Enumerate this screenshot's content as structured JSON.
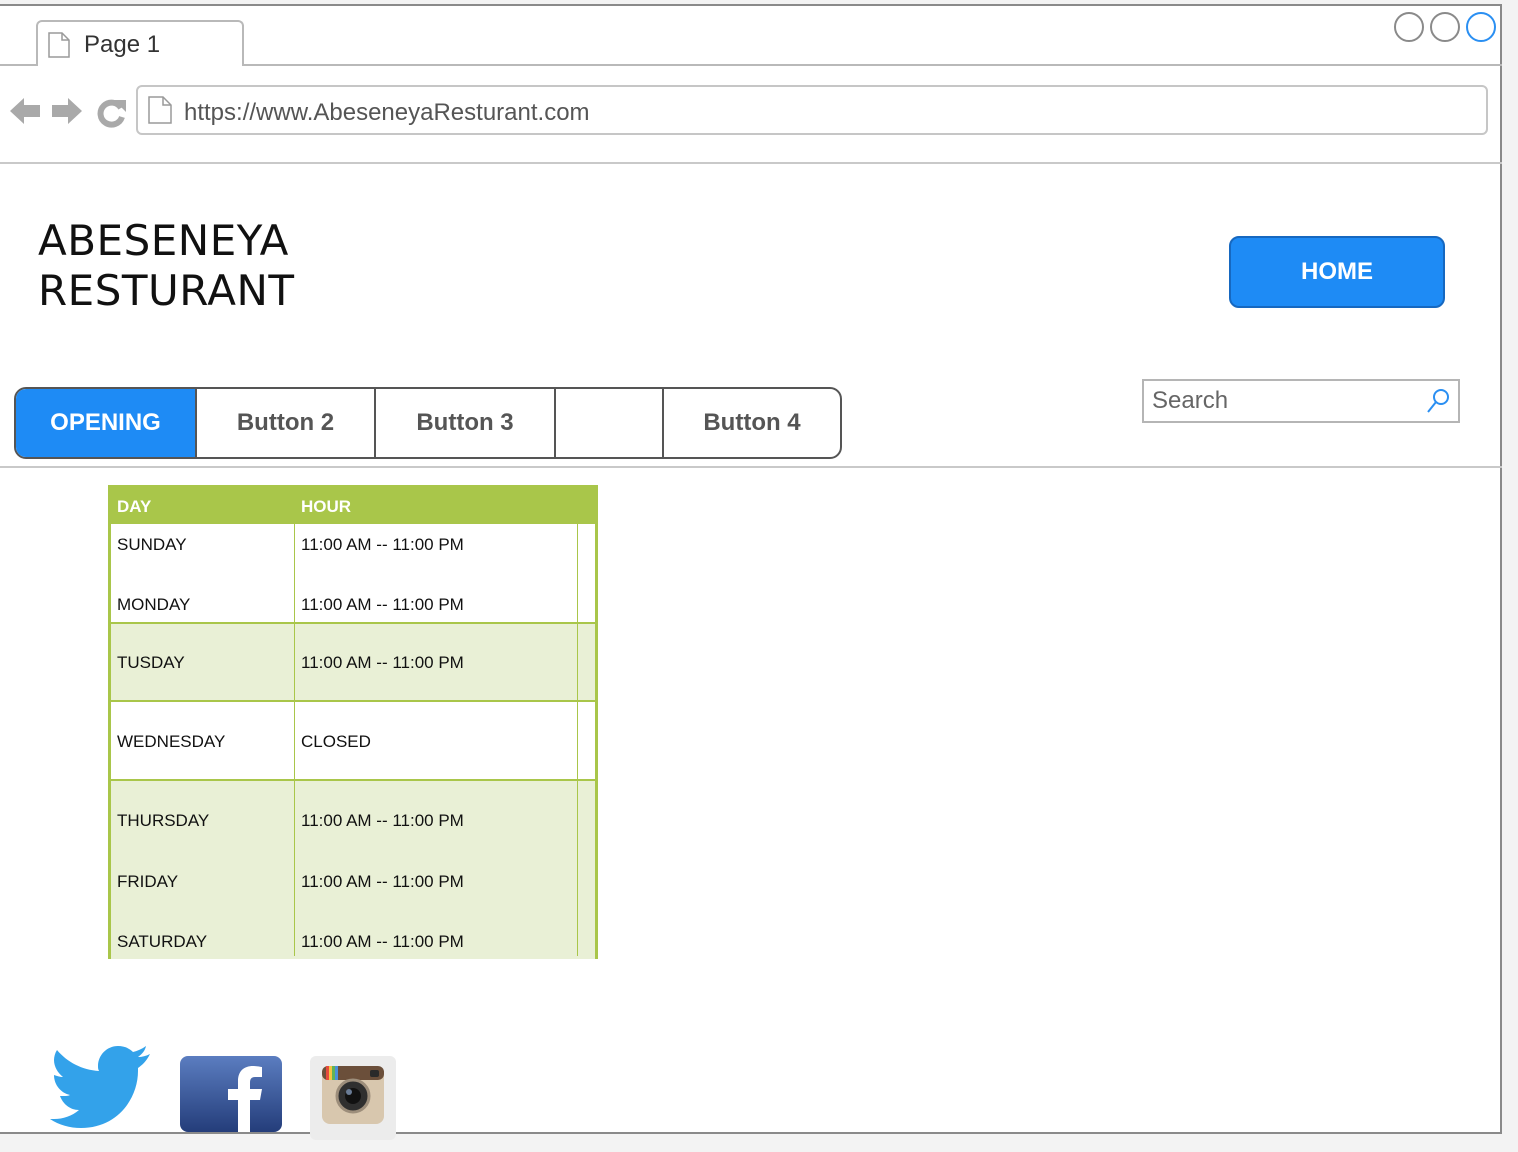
{
  "tab": {
    "label": "Page 1"
  },
  "address_bar": {
    "url": "https://www.AbeseneyaResturant.com"
  },
  "brand": {
    "line1": "ABESENEYA",
    "line2": "RESTURANT"
  },
  "home_button": {
    "label": "HOME"
  },
  "button_bar": [
    "OPENING",
    "Button 2",
    "Button 3",
    "",
    "Button 4"
  ],
  "search": {
    "placeholder": "Search"
  },
  "hours_table": {
    "headers": [
      "DAY",
      "HOUR"
    ],
    "rows": [
      [
        "SUNDAY",
        "11:00 AM  -- 11:00 PM"
      ],
      [
        "MONDAY",
        "11:00 AM  -- 11:00 PM"
      ],
      [
        "TUSDAY",
        "11:00 AM  -- 11:00 PM"
      ],
      [
        "WEDNESDAY",
        "CLOSED"
      ],
      [
        "THURSDAY",
        "11:00 AM  -- 11:00 PM"
      ],
      [
        "FRIDAY",
        "11:00 AM  -- 11:00 PM"
      ],
      [
        "SATURDAY",
        "11:00 AM  -- 11:00 PM"
      ]
    ]
  },
  "social_icons": [
    "twitter-icon",
    "facebook-icon",
    "instagram-icon"
  ],
  "colors": {
    "accent": "#1e8bf5",
    "table_green": "#a9c64a",
    "table_band": "#e9f0d6"
  }
}
